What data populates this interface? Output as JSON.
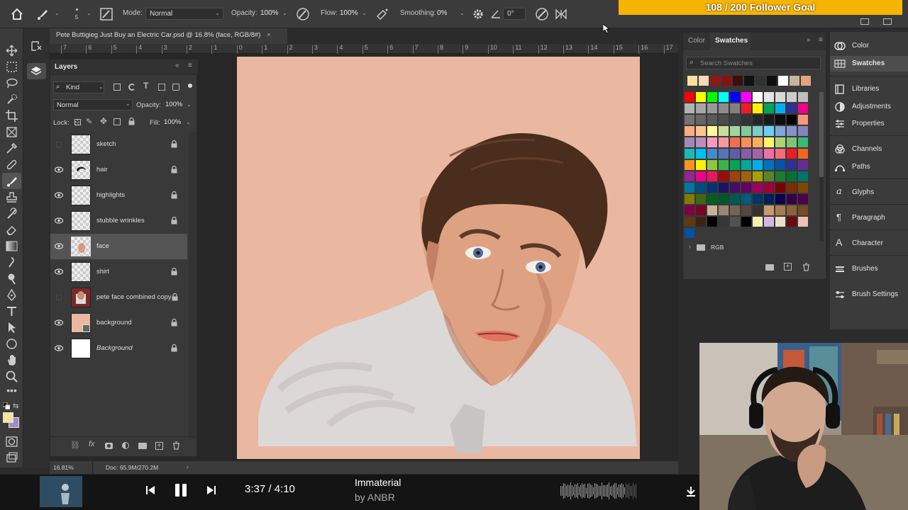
{
  "options_bar": {
    "brush_size": "5",
    "mode_label": "Mode:",
    "mode_value": "Normal",
    "opacity_label": "Opacity:",
    "opacity_value": "100%",
    "flow_label": "Flow:",
    "flow_value": "100%",
    "smoothing_label": "Smoothing:",
    "smoothing_value": "0%",
    "angle_value": "0°"
  },
  "stream_overlay": {
    "follower_goal": "108 / 200 Follower Goal"
  },
  "document": {
    "tab_title": "Pete Buttigieg Just Buy an Electric Car.psd @ 16.8% (face, RGB/8#)",
    "ruler_ticks": [
      "7",
      "6",
      "5",
      "4",
      "3",
      "2",
      "1",
      "0",
      "1",
      "2",
      "3",
      "4",
      "5",
      "6",
      "7",
      "8",
      "9",
      "10",
      "11",
      "12",
      "13",
      "14",
      "15",
      "16",
      "17"
    ],
    "zoom": "16.81%",
    "doc_size": "Doc: 65.9M/270.2M"
  },
  "layers_panel": {
    "tab_label": "Layers",
    "filter_kind": "Kind",
    "blend_mode": "Normal",
    "opacity_label": "Opacity:",
    "opacity_value": "100%",
    "lock_label": "Lock:",
    "fill_label": "Fill:",
    "fill_value": "100%",
    "layers": [
      {
        "name": "sketch",
        "visible": false,
        "locked": true
      },
      {
        "name": "hair",
        "visible": true,
        "locked": true
      },
      {
        "name": "highlights",
        "visible": true,
        "locked": true
      },
      {
        "name": "stubble wrinkles",
        "visible": true,
        "locked": true
      },
      {
        "name": "face",
        "visible": true,
        "locked": false,
        "selected": true
      },
      {
        "name": "shirt",
        "visible": true,
        "locked": true
      },
      {
        "name": "pete face combined copy",
        "visible": false,
        "locked": true
      },
      {
        "name": "background",
        "visible": true,
        "locked": true
      },
      {
        "name": "Background",
        "visible": true,
        "locked": true
      }
    ]
  },
  "swatches_panel": {
    "tabs": [
      "Color",
      "Swatches"
    ],
    "active_tab": "Swatches",
    "search_placeholder": "Search Swatches",
    "folder_label": "RGB",
    "recent_colors": [
      "#f6e39b",
      "#f5d9b8",
      "#8b1a1a",
      "#8c1010",
      "#3c0f0f",
      "#111111",
      "#323232",
      "#0e0e0e",
      "#ffffff",
      "#c7b39b",
      "#e5a37f"
    ],
    "grid_colors": [
      "#ff0000",
      "#ffff00",
      "#00ff00",
      "#00ffff",
      "#0000ff",
      "#ff00ff",
      "#ffffff",
      "#e6e6e6",
      "#d9d9d9",
      "#cccccc",
      "#bfbfbf",
      "#b3b3b3",
      "#a6a6a6",
      "#999999",
      "#8c8c8c",
      "#808080",
      "#ed1c24",
      "#fff200",
      "#00a651",
      "#00aeef",
      "#2e3192",
      "#ec008c",
      "#737373",
      "#666666",
      "#595959",
      "#4d4d4d",
      "#404040",
      "#333333",
      "#262626",
      "#1a1a1a",
      "#0d0d0d",
      "#000000",
      "#f7977a",
      "#f9ad81",
      "#fdc68a",
      "#fff79a",
      "#c4df9b",
      "#a3d39c",
      "#82ca9d",
      "#7bcdc8",
      "#6ecff6",
      "#7ea7d8",
      "#8493ca",
      "#8882be",
      "#a187be",
      "#bc8dbf",
      "#f49ac2",
      "#f6989d",
      "#f26c4f",
      "#f68e55",
      "#fbaf5c",
      "#fff467",
      "#acd372",
      "#7cc576",
      "#3bb878",
      "#1abbb4",
      "#00bff3",
      "#438ccb",
      "#5574b9",
      "#605ca8",
      "#855fa8",
      "#a763a8",
      "#f06ea9",
      "#f26d7d",
      "#ed1c24",
      "#f26522",
      "#f7941d",
      "#fff200",
      "#8dc63f",
      "#39b54a",
      "#00a651",
      "#00a99d",
      "#00aeef",
      "#0072bc",
      "#0054a6",
      "#2e3192",
      "#662d91",
      "#92278f",
      "#ec008c",
      "#ed145b",
      "#9e0b0f",
      "#a0410d",
      "#a36209",
      "#aba000",
      "#598527",
      "#1a7b30",
      "#007236",
      "#00746b",
      "#0076a3",
      "#004b80",
      "#003471",
      "#1b1464",
      "#440e62",
      "#630460",
      "#9e005d",
      "#9e0039",
      "#790000",
      "#7b2e00",
      "#7d4900",
      "#827b00",
      "#406618",
      "#005e20",
      "#005826",
      "#005952",
      "#005b7f",
      "#003663",
      "#002157",
      "#0d004c",
      "#32004b",
      "#4b0049",
      "#7b0046",
      "#7a0026",
      "#c7b299",
      "#998675",
      "#736357",
      "#534741",
      "#37302d",
      "#c69c6d",
      "#a67c52",
      "#8c6239",
      "#754c24",
      "#603913",
      "#3c2415",
      "#000000",
      "#363636",
      "#525252",
      "#000000",
      "#f5f0b0",
      "#d5b6e3",
      "#e8e0cc",
      "#6a0a0a",
      "#f0c0b0",
      "#0a4fa0"
    ]
  },
  "right_dock": {
    "items": [
      {
        "label": "Color",
        "icon": "color-wheel-icon"
      },
      {
        "label": "Swatches",
        "icon": "swatches-grid-icon",
        "active": true
      },
      {
        "label": "Libraries",
        "icon": "libraries-icon"
      },
      {
        "label": "Adjustments",
        "icon": "adjustments-icon"
      },
      {
        "label": "Properties",
        "icon": "properties-sliders-icon"
      },
      {
        "label": "Channels",
        "icon": "channels-icon"
      },
      {
        "label": "Paths",
        "icon": "paths-pen-icon"
      },
      {
        "label": "Glyphs",
        "icon": "glyphs-icon"
      },
      {
        "label": "Paragraph",
        "icon": "paragraph-icon"
      },
      {
        "label": "Character",
        "icon": "character-icon"
      },
      {
        "label": "Brushes",
        "icon": "brushes-icon"
      },
      {
        "label": "Brush Settings",
        "icon": "brush-settings-icon"
      }
    ]
  },
  "media_player": {
    "time": "3:37 / 4:10",
    "track_title": "Immaterial",
    "artist": "by ANBR"
  },
  "colors": {
    "canvas_bg": "#eab7a1",
    "panel_bg": "#393939",
    "goal_bar": "#f5b400",
    "foreground_swatch": "#f6e39b",
    "background_swatch": "#a08cc8"
  }
}
